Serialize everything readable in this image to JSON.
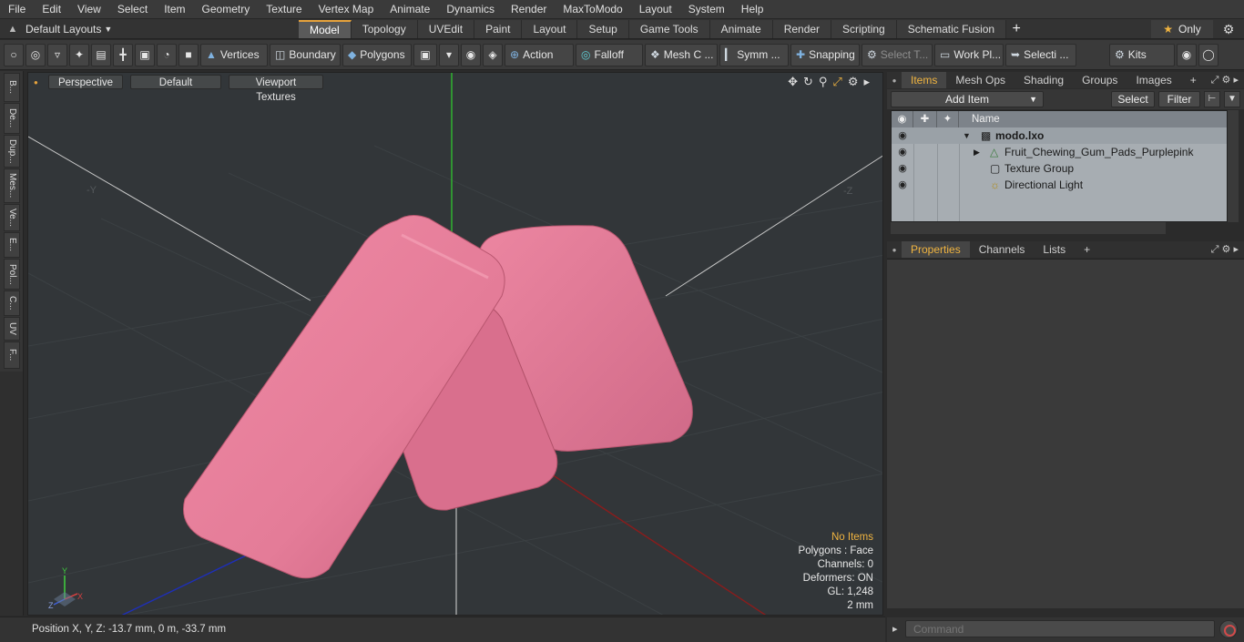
{
  "menu": [
    "File",
    "Edit",
    "View",
    "Select",
    "Item",
    "Geometry",
    "Texture",
    "Vertex Map",
    "Animate",
    "Dynamics",
    "Render",
    "MaxToModo",
    "Layout",
    "System",
    "Help"
  ],
  "layouts": {
    "label": "Default Layouts"
  },
  "tabs": [
    "Model",
    "Topology",
    "UVEdit",
    "Paint",
    "Layout",
    "Setup",
    "Game Tools",
    "Animate",
    "Render",
    "Scripting",
    "Schematic Fusion"
  ],
  "active_tab": "Model",
  "only_label": "Only",
  "toolbar": {
    "vertices": "Vertices",
    "boundary": "Boundary",
    "polygons": "Polygons",
    "action": "Action",
    "falloff": "Falloff",
    "mesh": "Mesh C ...",
    "symm": "Symm ...",
    "snapping": "Snapping",
    "select_t": "Select T...",
    "work_pl": "Work Pl...",
    "selecti": "Selecti ...",
    "kits": "Kits"
  },
  "left_tabs": [
    "B...",
    "De...",
    "Dup...",
    "Mes...",
    "Ve...",
    "E...",
    "Pol...",
    "C...",
    "UV",
    "F..."
  ],
  "viewport": {
    "perspective": "Perspective",
    "default": "Default",
    "textures": "Viewport Textures",
    "info": {
      "no_items": "No Items",
      "polygons": "Polygons : Face",
      "channels": "Channels: 0",
      "deformers": "Deformers: ON",
      "gl": "GL: 1,248",
      "scale": "2 mm"
    },
    "axis_y": "Y",
    "axis_z": "Z",
    "axis_x": "X",
    "corner_left": "-Y",
    "corner_right": "-Z",
    "colors": {
      "gum": "#e8809b",
      "gum_shadow": "#c25a78",
      "grid": "#3c4145",
      "y_axis": "#2fd12f",
      "x_axis": "#a02020",
      "z_axis": "#2030c0"
    }
  },
  "status": {
    "position": "Position X, Y, Z:   -13.7 mm, 0 m, -33.7 mm"
  },
  "items_panel": {
    "tabs": [
      "Items",
      "Mesh Ops",
      "Shading",
      "Groups",
      "Images"
    ],
    "active_tab": "Items",
    "add_item": "Add Item",
    "select": "Select",
    "filter": "Filter",
    "column_name": "Name",
    "rows": [
      {
        "label": "modo.lxo",
        "icon": "scene-icon"
      },
      {
        "label": "Fruit_Chewing_Gum_Pads_Purplepink",
        "icon": "mesh-icon"
      },
      {
        "label": "Texture Group",
        "icon": "texture-icon"
      },
      {
        "label": "Directional Light",
        "icon": "light-icon"
      }
    ]
  },
  "properties_panel": {
    "tabs": [
      "Properties",
      "Channels",
      "Lists"
    ],
    "active_tab": "Properties"
  },
  "command": {
    "placeholder": "Command"
  }
}
